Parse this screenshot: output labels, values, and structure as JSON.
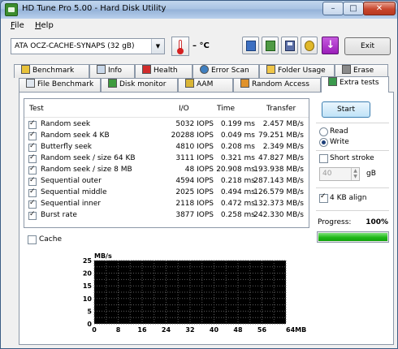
{
  "window": {
    "title": "HD Tune Pro 5.00 - Hard Disk Utility"
  },
  "caption_buttons": {
    "minimize": "–",
    "maximize": "□",
    "close": "✕"
  },
  "menu": [
    {
      "label": "File",
      "accel": "F"
    },
    {
      "label": "Help",
      "accel": "H"
    }
  ],
  "toolbar": {
    "drive": "ATA     OCZ-CACHE-SYNAPS (32 gB)",
    "temperature": "– °C",
    "exit_label": "Exit",
    "download_glyph": "↓",
    "icons": [
      "copy-text-icon",
      "copy-info-icon",
      "save-icon",
      "options-icon",
      "download-icon"
    ]
  },
  "tabs": {
    "row1": [
      "Benchmark",
      "Info",
      "Health",
      "Error Scan",
      "Folder Usage",
      "Erase"
    ],
    "row2": [
      "File Benchmark",
      "Disk monitor",
      "AAM",
      "Random Access",
      "Extra tests"
    ],
    "active": "Extra tests"
  },
  "tests": {
    "columns": {
      "test": "Test",
      "io": "I/O",
      "time": "Time",
      "transfer": "Transfer"
    },
    "rows": [
      {
        "name": "Random seek",
        "io": "5032 IOPS",
        "time": "0.199 ms",
        "transfer": "2.457 MB/s"
      },
      {
        "name": "Random seek 4 KB",
        "io": "20288 IOPS",
        "time": "0.049 ms",
        "transfer": "79.251 MB/s"
      },
      {
        "name": "Butterfly seek",
        "io": "4810 IOPS",
        "time": "0.208 ms",
        "transfer": "2.349 MB/s"
      },
      {
        "name": "Random seek / size 64 KB",
        "io": "3111 IOPS",
        "time": "0.321 ms",
        "transfer": "47.827 MB/s"
      },
      {
        "name": "Random seek / size 8 MB",
        "io": "48 IOPS",
        "time": "20.908 ms",
        "transfer": "193.938 MB/s"
      },
      {
        "name": "Sequential outer",
        "io": "4594 IOPS",
        "time": "0.218 ms",
        "transfer": "287.143 MB/s"
      },
      {
        "name": "Sequential middle",
        "io": "2025 IOPS",
        "time": "0.494 ms",
        "transfer": "126.579 MB/s"
      },
      {
        "name": "Sequential inner",
        "io": "2118 IOPS",
        "time": "0.472 ms",
        "transfer": "132.373 MB/s"
      },
      {
        "name": "Burst rate",
        "io": "3877 IOPS",
        "time": "0.258 ms",
        "transfer": "242.330 MB/s"
      }
    ]
  },
  "controls": {
    "start_label": "Start",
    "read_label": "Read",
    "write_label": "Write",
    "mode_selected": "Write",
    "short_stroke_label": "Short stroke",
    "short_stroke_checked": false,
    "stroke_value": "40",
    "stroke_unit": "gB",
    "align_label": "4 KB align",
    "align_checked": true,
    "progress_label": "Progress:",
    "progress_text": "100%",
    "progress_fraction": 1.0,
    "cache_label": "Cache",
    "cache_checked": false
  },
  "chart_data": {
    "type": "line",
    "ylabel": "MB/s",
    "xlabel": "MB",
    "yticks": [
      25,
      20,
      15,
      10,
      5,
      0
    ],
    "xticks": [
      "0",
      "8",
      "16",
      "24",
      "32",
      "40",
      "48",
      "56",
      "64MB"
    ],
    "ylim": [
      0,
      25
    ],
    "xlim": [
      0,
      64
    ],
    "grid": true,
    "series": []
  }
}
